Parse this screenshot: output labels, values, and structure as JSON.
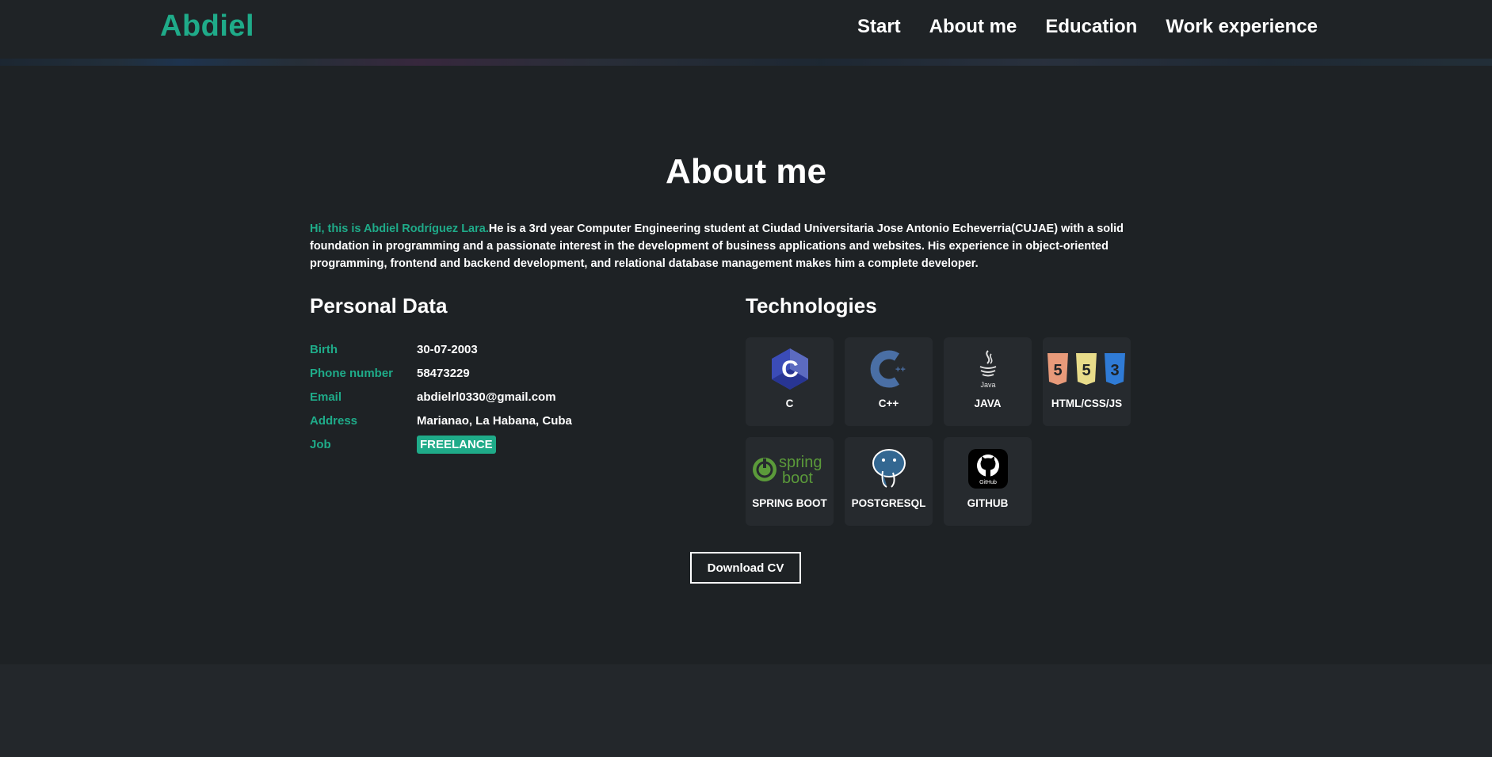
{
  "header": {
    "brand": "Abdiel",
    "nav": [
      "Start",
      "About me",
      "Education",
      "Work experience"
    ]
  },
  "about": {
    "title": "About me",
    "intro_highlight": "Hi, this is Abdiel Rodríguez Lara.",
    "intro_text": "He is a 3rd year Computer Engineering student at Ciudad Universitaria Jose Antonio Echeverria(CUJAE) with a solid foundation in programming and a passionate interest in the development of business applications and websites. His experience in object-oriented programming, frontend and backend development, and relational database management makes him a complete developer."
  },
  "personal_data": {
    "title": "Personal Data",
    "rows": [
      {
        "key": "Birth",
        "value": "30-07-2003"
      },
      {
        "key": "Phone number",
        "value": "58473229"
      },
      {
        "key": "Email",
        "value": "abdielrl0330@gmail.com"
      },
      {
        "key": "Address",
        "value": "Marianao, La Habana, Cuba"
      },
      {
        "key": "Job",
        "value": "FREELANCE"
      }
    ]
  },
  "technologies": {
    "title": "Technologies",
    "items": [
      {
        "label": "C",
        "icon": "c-icon"
      },
      {
        "label": "C++",
        "icon": "cpp-icon"
      },
      {
        "label": "JAVA",
        "icon": "java-icon"
      },
      {
        "label": "HTML/CSS/JS",
        "icon": "html-css-js-icon"
      },
      {
        "label": "SPRING BOOT",
        "icon": "spring-boot-icon"
      },
      {
        "label": "POSTGRESQL",
        "icon": "postgresql-icon"
      },
      {
        "label": "GITHUB",
        "icon": "github-icon"
      }
    ],
    "icon_text": {
      "java": "Java",
      "spring": "spring",
      "boot": "boot",
      "github": "GitHub"
    }
  },
  "cv_button": "Download CV",
  "colors": {
    "accent": "#1fab89",
    "background": "#1e2225",
    "card": "#262a2e"
  }
}
